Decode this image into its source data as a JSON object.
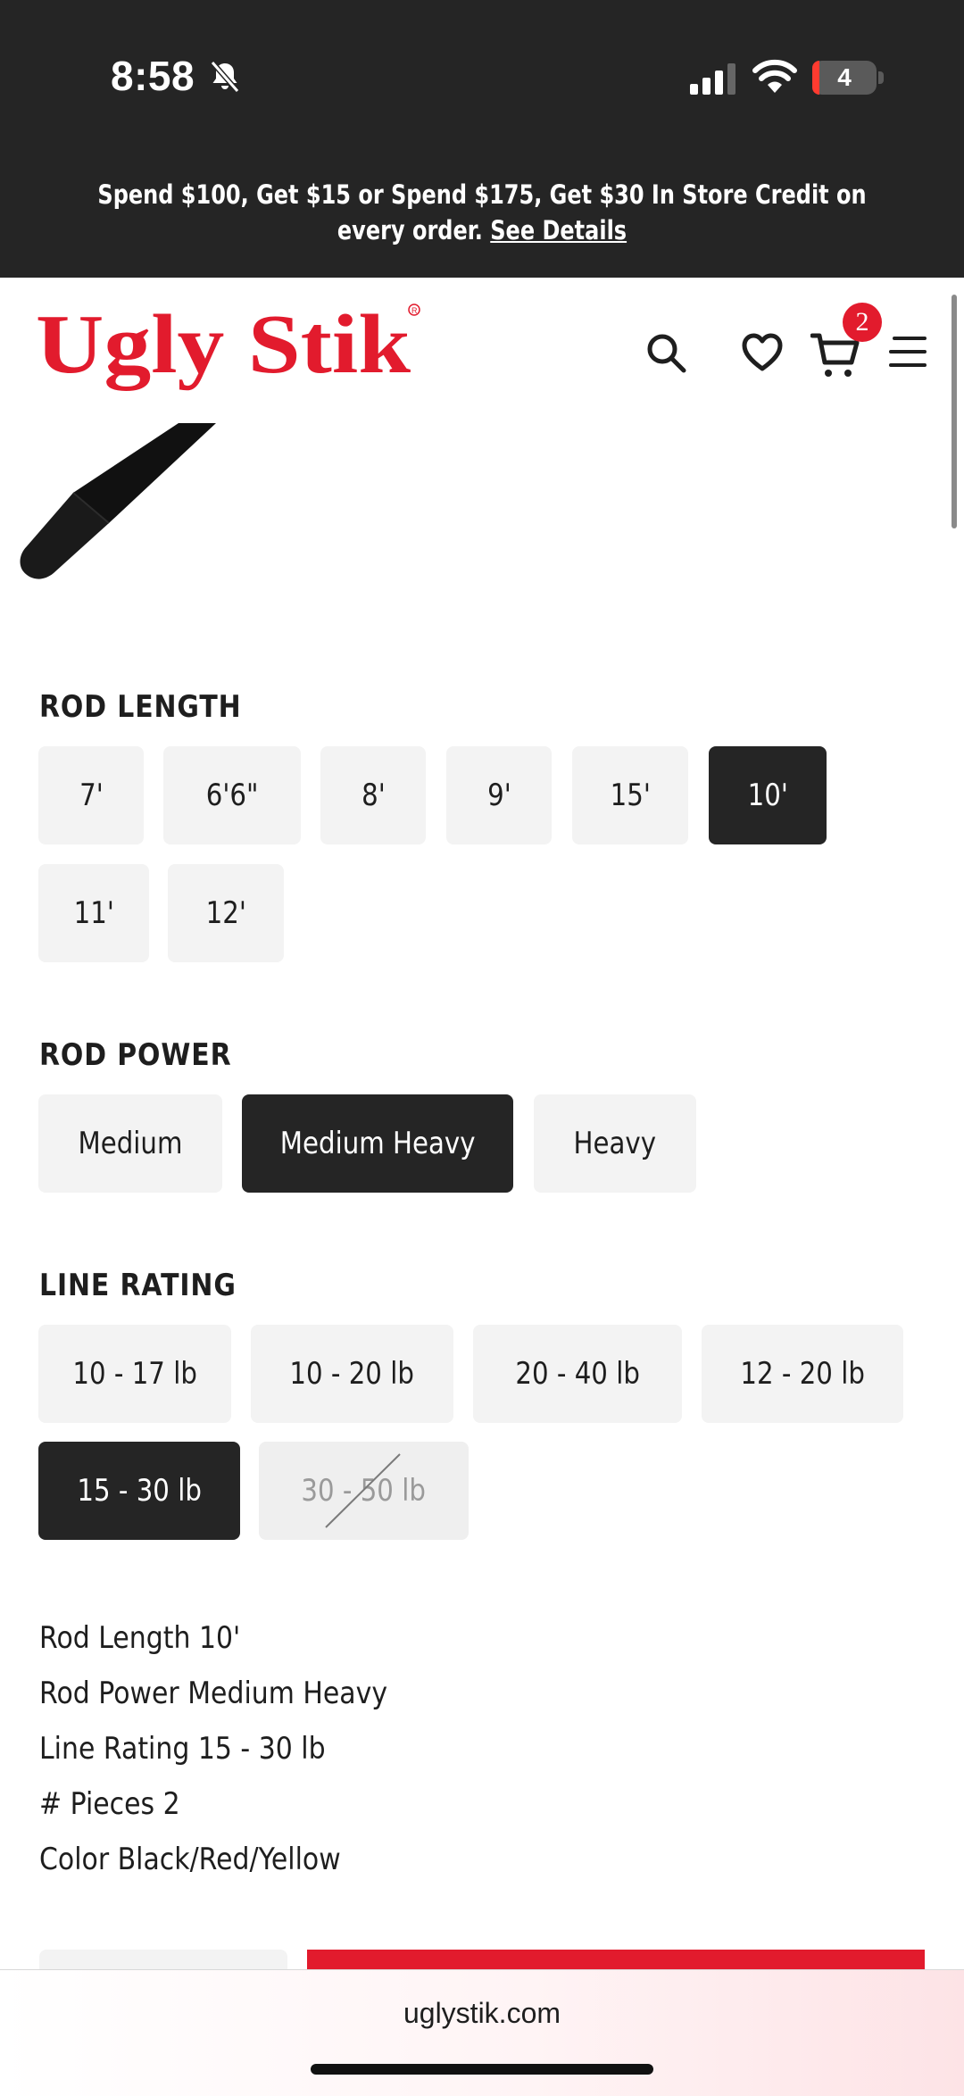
{
  "status_bar": {
    "time": "8:58",
    "battery": "4",
    "icons": [
      "bell-slash-icon",
      "cellular-signal-icon",
      "wifi-icon",
      "battery-icon"
    ]
  },
  "promo": {
    "text": "Spend $100, Get $15 or Spend $175, Get $30 In Store Credit on every order.",
    "link": "See Details"
  },
  "header": {
    "logo_text": "Ugly Stik",
    "cart_count": "2",
    "icons": [
      "search-icon",
      "heart-icon",
      "cart-icon",
      "menu-icon"
    ]
  },
  "options": {
    "rod_length": {
      "title": "ROD LENGTH",
      "items": [
        "7'",
        "6'6\"",
        "8'",
        "9'",
        "15'",
        "10'",
        "11'",
        "12'"
      ],
      "selected": "10'"
    },
    "rod_power": {
      "title": "ROD POWER",
      "items": [
        "Medium",
        "Medium Heavy",
        "Heavy"
      ],
      "selected": "Medium Heavy"
    },
    "line_rating": {
      "title": "LINE RATING",
      "items": [
        "10 - 17 lb",
        "10 - 20 lb",
        "20 - 40 lb",
        "12 - 20 lb",
        "15 - 30 lb",
        "30 - 50 lb"
      ],
      "selected": "15 - 30 lb",
      "unavailable": [
        "30 - 50 lb"
      ]
    }
  },
  "summary": [
    "Rod Length 10'",
    "Rod Power Medium Heavy",
    "Line Rating 15 - 30 lb",
    "# Pieces 2",
    "Color Black/Red/Yellow"
  ],
  "browser": {
    "url": "uglystik.com"
  },
  "colors": {
    "brand_red": "#e21b2d",
    "dark": "#252525",
    "option_bg": "#f3f3f3"
  }
}
